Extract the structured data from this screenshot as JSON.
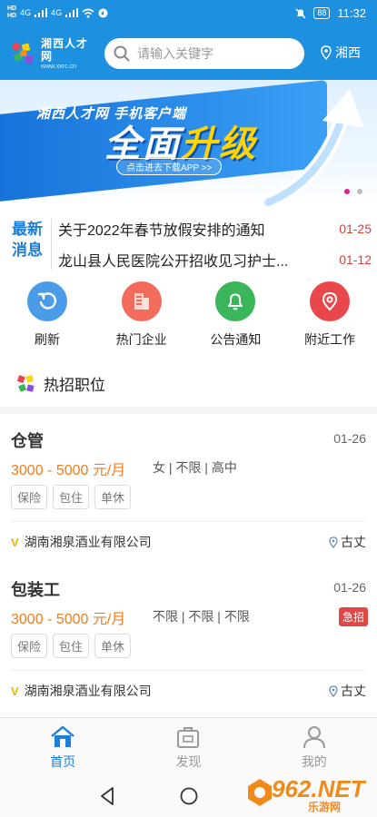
{
  "status_bar": {
    "left_labels": [
      "HD",
      "HD",
      "4G",
      "4G"
    ],
    "battery": "88",
    "time": "11:32"
  },
  "header": {
    "logo_title": "湘西人才网",
    "logo_sub": "www.xxrc.cn",
    "search_placeholder": "请输入关键字",
    "location": "湘西"
  },
  "banner": {
    "line1": "湘西人才网 手机客户端",
    "line2_prefix": "全面",
    "line2_highlight": "升级",
    "button": "点击进去下载APP >>",
    "slide_count": 2,
    "active_slide": 1
  },
  "news": {
    "label_line1": "最新",
    "label_line2": "消息",
    "items": [
      {
        "title": "关于2022年春节放假安排的通知",
        "date": "01-25"
      },
      {
        "title": "龙山县人民医院公开招收见习护士...",
        "date": "01-12"
      }
    ]
  },
  "quick_menu": [
    {
      "label": "刷新",
      "icon": "refresh-icon",
      "color": "#4a9be8"
    },
    {
      "label": "热门企业",
      "icon": "building-icon",
      "color": "#f26b5b"
    },
    {
      "label": "公告通知",
      "icon": "bell-icon",
      "color": "#3bb55a"
    },
    {
      "label": "附近工作",
      "icon": "location-pin-icon",
      "color": "#e9474c"
    }
  ],
  "hot_jobs": {
    "title": "热招职位",
    "jobs": [
      {
        "title": "仓管",
        "date": "01-26",
        "salary": "3000 - 5000 元/月",
        "requirements": "女 | 不限 | 高中",
        "urgent": "",
        "tags": [
          "保险",
          "包住",
          "单休"
        ],
        "company": "湖南湘泉酒业有限公司",
        "location": "古丈"
      },
      {
        "title": "包装工",
        "date": "01-26",
        "salary": "3000 - 5000 元/月",
        "requirements": "不限 | 不限 | 不限",
        "urgent": "急招",
        "tags": [
          "保险",
          "包住",
          "单休"
        ],
        "company": "湖南湘泉酒业有限公司",
        "location": "古丈"
      }
    ]
  },
  "bottom_nav": [
    {
      "label": "首页",
      "icon": "home-icon",
      "active": true
    },
    {
      "label": "发现",
      "icon": "briefcase-icon",
      "active": false
    },
    {
      "label": "我的",
      "icon": "user-icon",
      "active": false
    }
  ],
  "watermark": {
    "text": "962.NET",
    "sub": "乐游网"
  },
  "colors": {
    "brand_blue": "#1e90e0",
    "salary_orange": "#f07d22",
    "date_red": "#d9413b",
    "urgent_red": "#e04848"
  }
}
